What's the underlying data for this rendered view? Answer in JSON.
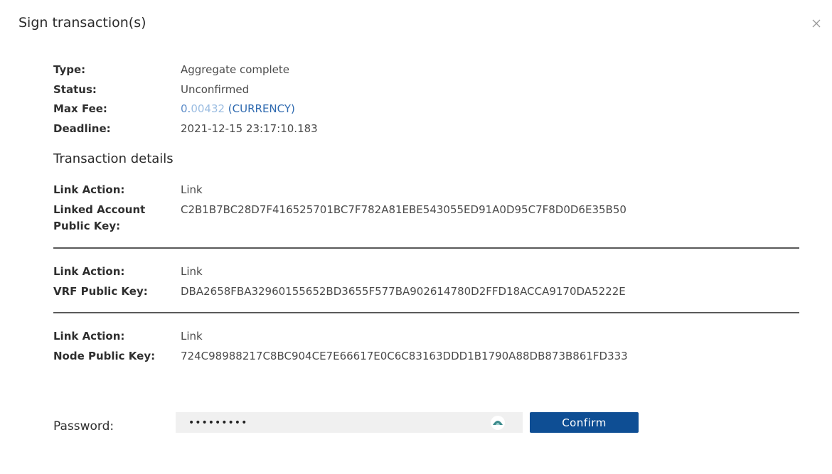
{
  "modal": {
    "title": "Sign transaction(s)"
  },
  "summary": {
    "type_label": "Type:",
    "type_value": "Aggregate complete",
    "status_label": "Status:",
    "status_value": "Unconfirmed",
    "max_fee_label": "Max Fee:",
    "max_fee_int": "0.",
    "max_fee_decimals": "00432",
    "max_fee_currency": " (CURRENCY)",
    "deadline_label": "Deadline:",
    "deadline_value": "2021-12-15 23:17:10.183"
  },
  "details": {
    "title": "Transaction details",
    "items": [
      {
        "action_label": "Link Action:",
        "action_value": "Link",
        "key_label": "Linked Account Public Key:",
        "key_value": "C2B1B7BC28D7F416525701BC7F782A81EBE543055ED91A0D95C7F8D0D6E35B50"
      },
      {
        "action_label": "Link Action:",
        "action_value": "Link",
        "key_label": "VRF Public Key:",
        "key_value": "DBA2658FBA32960155652BD3655F577BA902614780D2FFD18ACCA9170DA5222E"
      },
      {
        "action_label": "Link Action:",
        "action_value": "Link",
        "key_label": "Node Public Key:",
        "key_value": "724C98988217C8BC904CE7E66617E0C6C83163DDD1B1790A88DB873B861FD333"
      }
    ]
  },
  "password": {
    "label": "Password:",
    "value": "•••••••••"
  },
  "confirm": {
    "label": "Confirm"
  },
  "icons": {
    "close": "close-icon",
    "visibility": "eye-toggle-icon"
  },
  "colors": {
    "primary_button": "#0e4e94",
    "fee_link": "#2f6ab0",
    "divider": "#5a5a5a",
    "input_bg": "#f0f0f0"
  }
}
